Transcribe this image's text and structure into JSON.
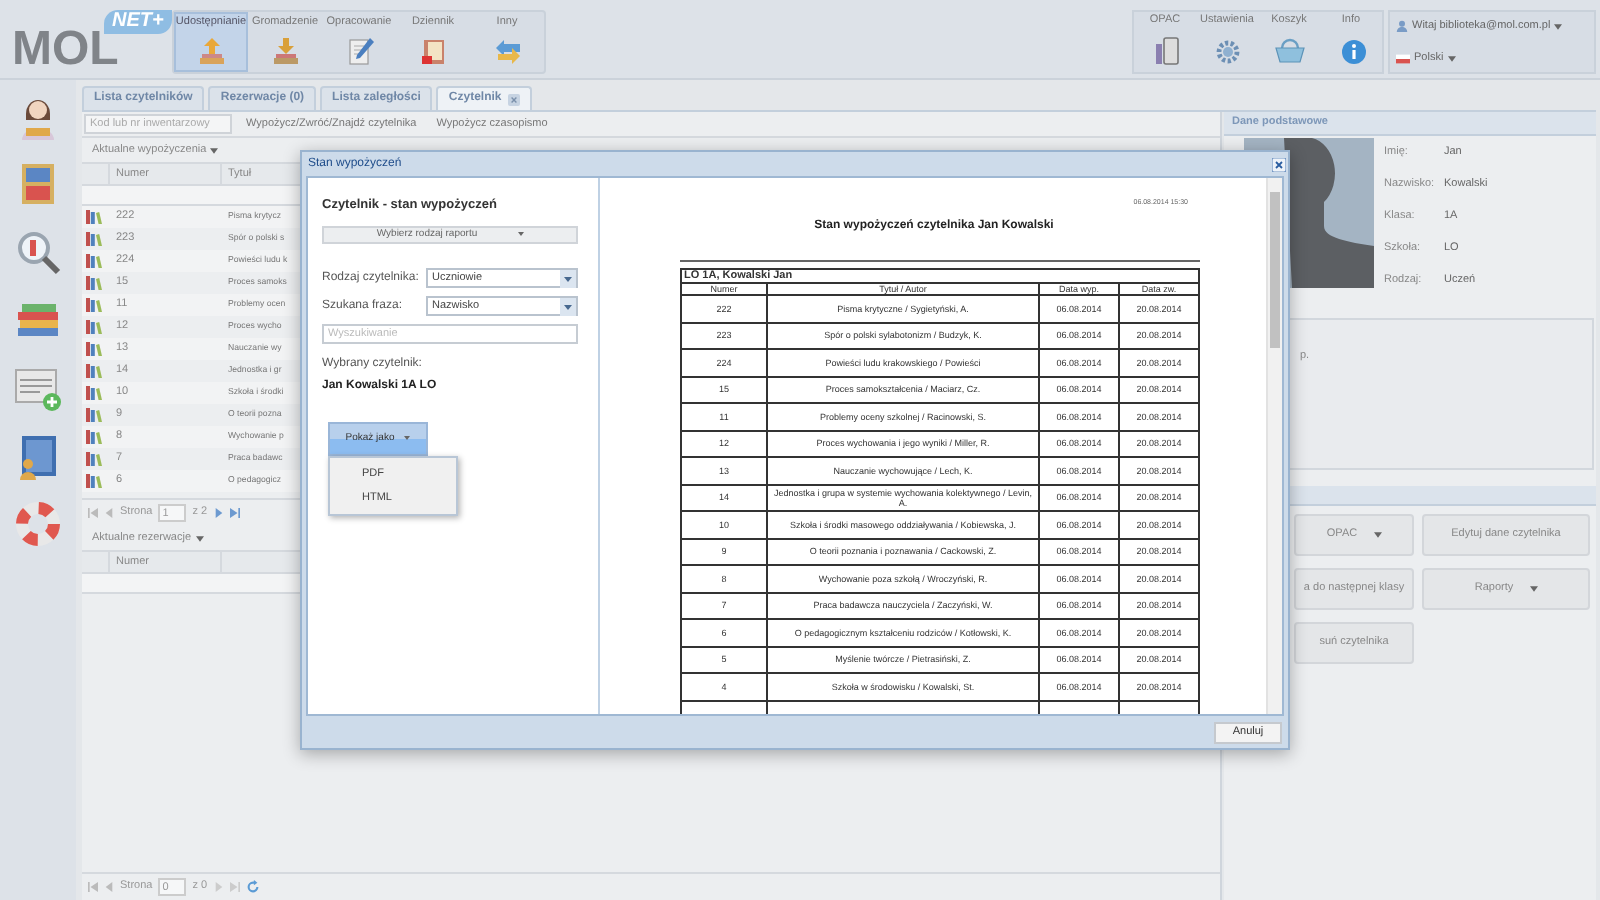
{
  "header": {
    "logo": "MOL",
    "badge": "NET+",
    "nav": [
      {
        "label": "Udostępnianie",
        "selected": true
      },
      {
        "label": "Gromadzenie",
        "selected": false
      },
      {
        "label": "Opracowanie",
        "selected": false
      },
      {
        "label": "Dziennik",
        "selected": false
      },
      {
        "label": "Inny",
        "selected": false
      }
    ],
    "tools": [
      "OPAC",
      "Ustawienia",
      "Koszyk",
      "Info"
    ],
    "user": "Witaj biblioteka@mol.com.pl",
    "language": "Polski"
  },
  "tabs": [
    {
      "label": "Lista czytelników",
      "selected": false,
      "closable": false
    },
    {
      "label": "Rezerwacje (0)",
      "selected": false,
      "closable": false
    },
    {
      "label": "Lista zaległości",
      "selected": false,
      "closable": false
    },
    {
      "label": "Czytelnik",
      "selected": true,
      "closable": true
    }
  ],
  "toolbar": {
    "placeholder": "Kod lub nr inwentarzowy",
    "buttons": [
      "Wypożycz/Zwróć/Znajdź czytelnika",
      "Wypożycz czasopismo"
    ]
  },
  "loans": {
    "title": "Aktualne wypożyczenia",
    "columns": [
      "Numer",
      "Tytuł"
    ],
    "rows": [
      {
        "number": "222",
        "title": "Pisma krytycz"
      },
      {
        "number": "223",
        "title": "Spór o polski s"
      },
      {
        "number": "224",
        "title": "Powieści ludu k"
      },
      {
        "number": "15",
        "title": "Proces samoks"
      },
      {
        "number": "11",
        "title": "Problemy ocen"
      },
      {
        "number": "12",
        "title": "Proces wycho"
      },
      {
        "number": "13",
        "title": "Nauczanie wy"
      },
      {
        "number": "14",
        "title": "Jednostka i gr"
      },
      {
        "number": "10",
        "title": "Szkoła i środki"
      },
      {
        "number": "9",
        "title": "O teorii pozna"
      },
      {
        "number": "8",
        "title": "Wychowanie p"
      },
      {
        "number": "7",
        "title": "Praca badawc"
      },
      {
        "number": "6",
        "title": "O pedagogicz"
      }
    ],
    "pager": {
      "label": "Strona",
      "page": "1",
      "total": "z 2"
    }
  },
  "reservations": {
    "title": "Aktualne rezerwacje",
    "columns": [
      "Numer"
    ],
    "pager": {
      "label": "Strona",
      "page": "0",
      "total": "z 0"
    }
  },
  "reader_panel": {
    "title": "Dane podstawowe",
    "fields": [
      {
        "label": "Imię:",
        "value": "Jan"
      },
      {
        "label": "Nazwisko:",
        "value": "Kowalski"
      },
      {
        "label": "Klasa:",
        "value": "1A"
      },
      {
        "label": "Szkoła:",
        "value": "LO"
      },
      {
        "label": "Rodzaj:",
        "value": "Uczeń"
      }
    ],
    "note": "p.",
    "buttons": [
      {
        "label": "OPAC",
        "kind": "dropdown"
      },
      {
        "label": "Edytuj dane czytelnika",
        "kind": "plain"
      },
      {
        "label": "a do następnej klasy",
        "kind": "plain"
      },
      {
        "label": "Raporty",
        "kind": "dropdown"
      },
      {
        "label": "suń czytelnika",
        "kind": "plain"
      }
    ]
  },
  "dialog": {
    "title": "Stan wypożyczeń",
    "heading": "Czytelnik - stan wypożyczeń",
    "report_type_button": "Wybierz rodzaj raportu",
    "reader_type": {
      "label": "Rodzaj czytelnika:",
      "value": "Uczniowie"
    },
    "search_by": {
      "label": "Szukana fraza:",
      "value": "Nazwisko"
    },
    "search": {
      "placeholder": "Wyszukiwanie"
    },
    "selected_reader_label": "Wybrany czytelnik:",
    "selected_reader": "Jan Kowalski 1A LO",
    "show_as": {
      "label": "Pokaż jako",
      "expanded": true,
      "options": [
        "PDF",
        "HTML"
      ]
    },
    "report": {
      "timestamp": "06.08.2014 15:30",
      "title": "Stan wypożyczeń czytelnika Jan Kowalski",
      "group": "LO 1A, Kowalski Jan",
      "columns": [
        "Numer",
        "Tytuł / Autor",
        "Data wyp.",
        "Data zw."
      ],
      "rows": [
        {
          "number": "222",
          "title": "Pisma krytyczne / Sygietyński, A.",
          "loaned": "06.08.2014",
          "due": "20.08.2014"
        },
        {
          "number": "223",
          "title": "Spór o polski sylabotonizm / Budzyk, K.",
          "loaned": "06.08.2014",
          "due": "20.08.2014"
        },
        {
          "number": "224",
          "title": "Powieści ludu krakowskiego / Powieści",
          "loaned": "06.08.2014",
          "due": "20.08.2014"
        },
        {
          "number": "15",
          "title": "Proces samokształcenia / Maciarz, Cz.",
          "loaned": "06.08.2014",
          "due": "20.08.2014"
        },
        {
          "number": "11",
          "title": "Problemy oceny szkolnej / Racinowski, S.",
          "loaned": "06.08.2014",
          "due": "20.08.2014"
        },
        {
          "number": "12",
          "title": "Proces wychowania i jego wyniki / Miller, R.",
          "loaned": "06.08.2014",
          "due": "20.08.2014"
        },
        {
          "number": "13",
          "title": "Nauczanie wychowujące / Lech, K.",
          "loaned": "06.08.2014",
          "due": "20.08.2014"
        },
        {
          "number": "14",
          "title": "Jednostka i grupa w systemie wychowania kolektywnego / Levin, A.",
          "loaned": "06.08.2014",
          "due": "20.08.2014"
        },
        {
          "number": "10",
          "title": "Szkoła i środki masowego oddziaływania / Kobiewska, J.",
          "loaned": "06.08.2014",
          "due": "20.08.2014"
        },
        {
          "number": "9",
          "title": "O teorii poznania i poznawania / Cackowski, Z.",
          "loaned": "06.08.2014",
          "due": "20.08.2014"
        },
        {
          "number": "8",
          "title": "Wychowanie poza szkołą / Wroczyński, R.",
          "loaned": "06.08.2014",
          "due": "20.08.2014"
        },
        {
          "number": "7",
          "title": "Praca badawcza nauczyciela / Zaczyński, W.",
          "loaned": "06.08.2014",
          "due": "20.08.2014"
        },
        {
          "number": "6",
          "title": "O pedagogicznym kształceniu rodziców / Kotłowski, K.",
          "loaned": "06.08.2014",
          "due": "20.08.2014"
        },
        {
          "number": "5",
          "title": "Myślenie twórcze / Pietrasiński, Z.",
          "loaned": "06.08.2014",
          "due": "20.08.2014"
        },
        {
          "number": "4",
          "title": "Szkoła w środowisku / Kowalski, St.",
          "loaned": "06.08.2014",
          "due": "20.08.2014"
        }
      ]
    },
    "cancel": "Anuluj"
  }
}
